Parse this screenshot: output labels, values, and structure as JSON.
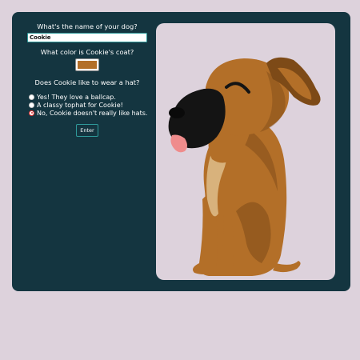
{
  "form": {
    "name_question": "What's the name of your dog?",
    "name_value": "Cookie",
    "color_question": "What color is Cookie's coat?",
    "coat_color": "#b36f28",
    "hat_question": "Does Cookie like to wear a hat?",
    "hat_options": [
      {
        "label": "Yes! They love a ballcap.",
        "checked": false
      },
      {
        "label": "A classy tophat for Cookie!",
        "checked": false
      },
      {
        "label": "No, Cookie doesn't really like hats.",
        "checked": true
      }
    ],
    "enter_label": "Enter"
  },
  "colors": {
    "card_bg": "#143540",
    "page_bg": "#ddd2dc",
    "accent_border": "#2f9a9a",
    "dog_coat": "#b36f28",
    "dog_coat_dark": "#7d4a17",
    "dog_muzzle": "#141414",
    "dog_chest": "#d8b27c",
    "dog_tongue": "#ef8c8c"
  }
}
